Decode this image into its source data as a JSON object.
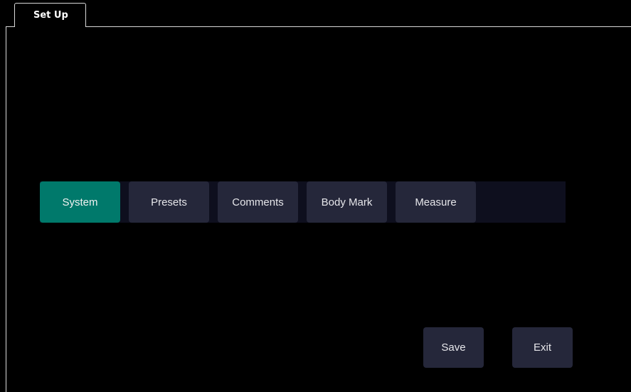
{
  "tab": {
    "label": "Set Up"
  },
  "nav": {
    "items": [
      {
        "label": "System",
        "active": true
      },
      {
        "label": "Presets",
        "active": false
      },
      {
        "label": "Comments",
        "active": false
      },
      {
        "label": "Body Mark",
        "active": false
      },
      {
        "label": "Measure",
        "active": false
      }
    ]
  },
  "actions": {
    "save_label": "Save",
    "exit_label": "Exit"
  },
  "colors": {
    "background": "#000000",
    "active_button": "#00796b",
    "button": "#25273a",
    "strip": "#0e0f1e",
    "tab_border": "#d9d9d9"
  }
}
